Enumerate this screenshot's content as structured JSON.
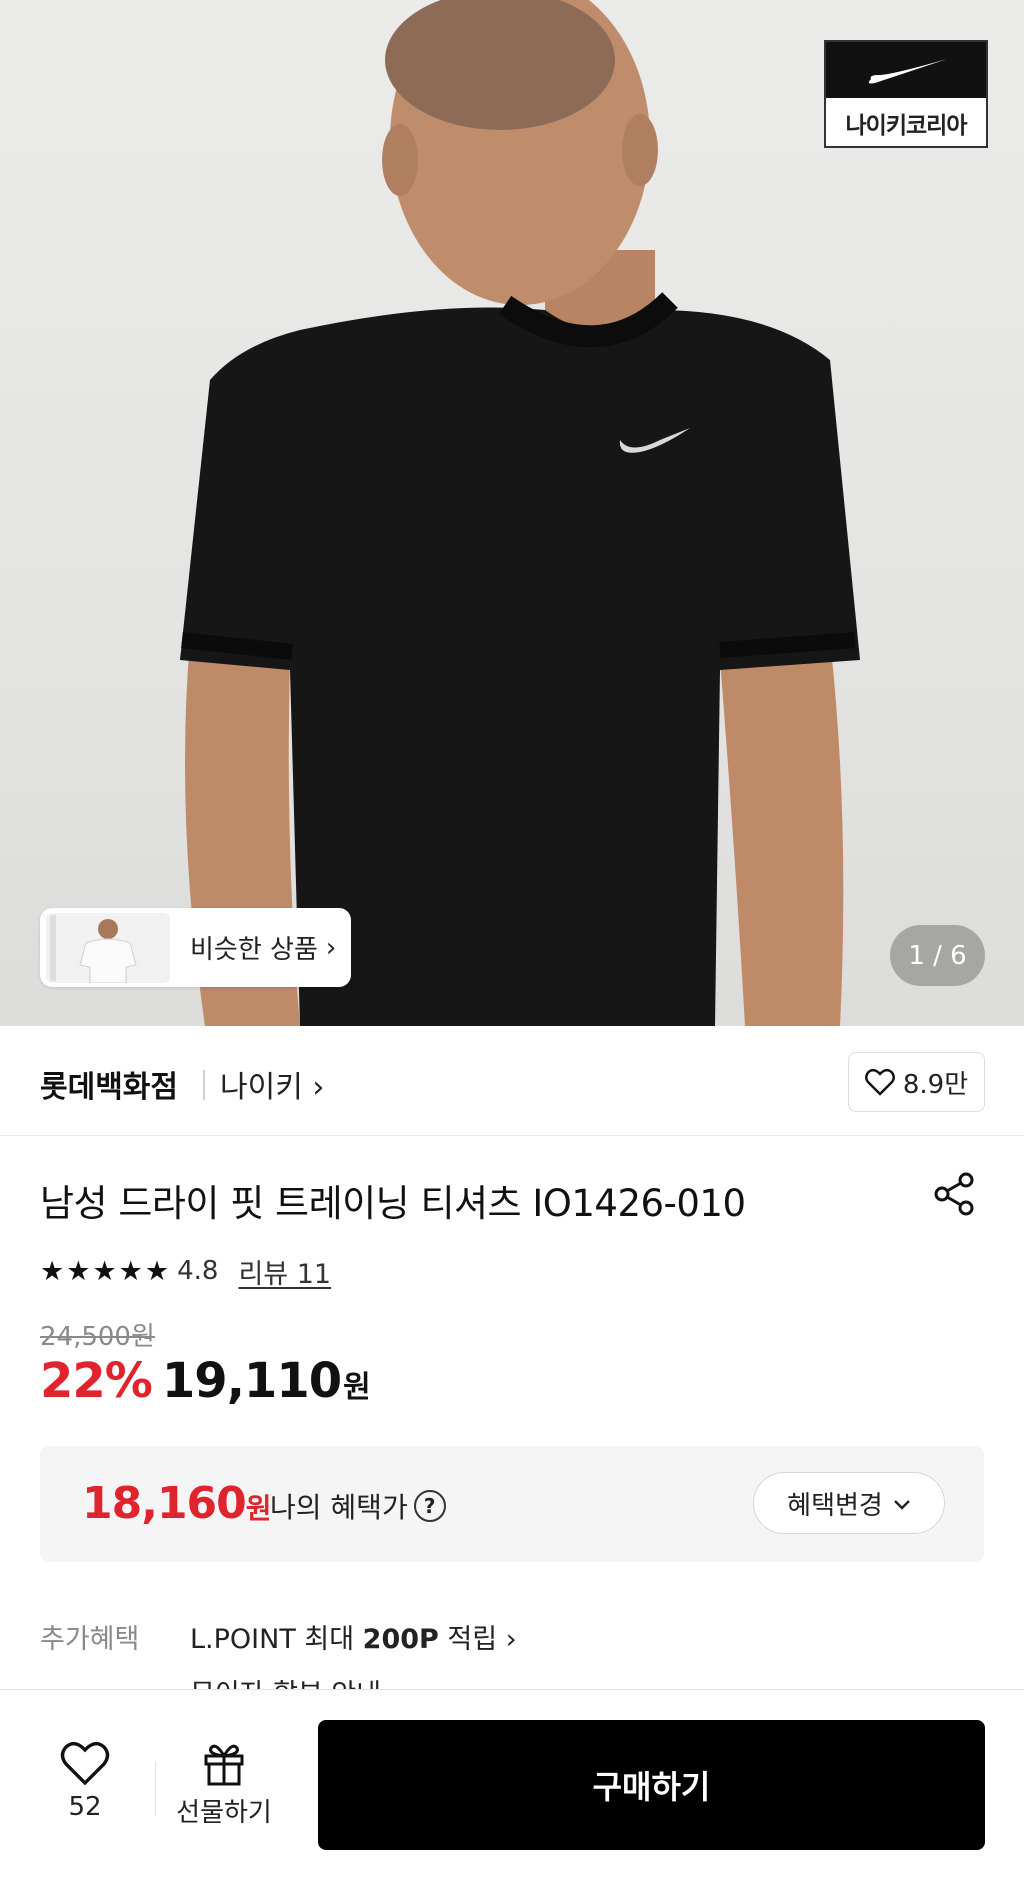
{
  "hero": {
    "brand_logo_text": "나이키코리아",
    "similar_label": "비슷한 상품",
    "page_indicator": "1 / 6"
  },
  "store": {
    "name": "롯데백화점",
    "brand": "나이키",
    "wish_count": "8.9만"
  },
  "product": {
    "title": "남성 드라이 핏 트레이닝 티셔츠 IO1426-010",
    "rating": "4.8",
    "rating_stars": 5,
    "review_link": "리뷰 11",
    "original_price": "24,500원",
    "discount": "22%",
    "sale_price": "19,110",
    "currency": "원"
  },
  "benefit": {
    "price": "18,160",
    "currency": "원",
    "label": "나의 혜택가",
    "change_button": "혜택변경"
  },
  "extra": {
    "label": "추가혜택",
    "lpoint_prefix": "L.POINT 최대 ",
    "lpoint_amount": "200P",
    "lpoint_suffix": " 적립",
    "second_item": "무이자 할부 안내"
  },
  "bottom_bar": {
    "like_count": "52",
    "gift_label": "선물하기",
    "buy_label": "구매하기"
  },
  "colors": {
    "accent_red": "#e0242e",
    "buy_button": "#000000"
  }
}
